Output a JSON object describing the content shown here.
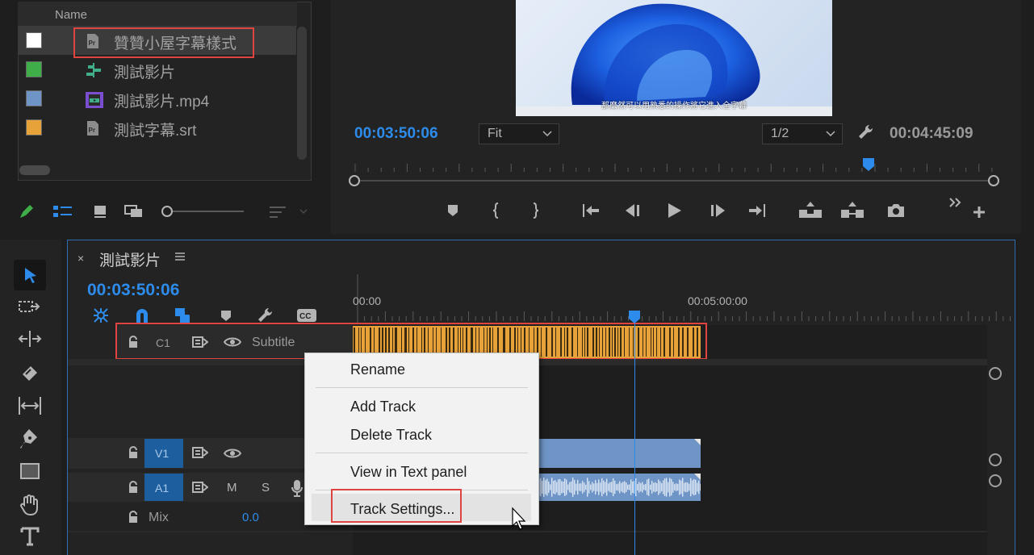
{
  "project": {
    "column_name": "Name",
    "items": [
      {
        "name": "贊贊小屋字幕樣式",
        "swatch": "#ffffff",
        "icon": "premiere-file-icon"
      },
      {
        "name": "測試影片",
        "swatch": "#3fae49",
        "icon": "sequence-icon"
      },
      {
        "name": "測試影片.mp4",
        "swatch": "#6f94c6",
        "icon": "video-clip-icon"
      },
      {
        "name": "測試字幕.srt",
        "swatch": "#e8a23a",
        "icon": "premiere-file-icon"
      }
    ]
  },
  "monitor": {
    "timecode": "00:03:50:06",
    "zoom": "Fit",
    "resolution": "1/2",
    "duration": "00:04:45:09",
    "subtitle_text": "那麼然可以用熟悉的操作將它進入全字幕",
    "playhead_fraction": 0.81
  },
  "sequence": {
    "name": "測試影片",
    "timecode": "00:03:50:06",
    "ruler": [
      "00:00",
      "00:05:00:00"
    ],
    "tracks": {
      "c1": {
        "id": "C1",
        "name": "Subtitle"
      },
      "v1": {
        "id": "V1"
      },
      "a1": {
        "id": "A1",
        "mute": "M",
        "solo": "S"
      },
      "mix": {
        "label": "Mix",
        "value": "0.0"
      }
    }
  },
  "context_menu": {
    "items": [
      "Rename",
      "Add Track",
      "Delete Track",
      "View in Text panel",
      "Track Settings..."
    ]
  },
  "colors": {
    "accent": "#2d8ceb",
    "highlight_red": "#e0443e",
    "subtitle_clip": "#e8a23a",
    "video_clip": "#6f94c6"
  }
}
